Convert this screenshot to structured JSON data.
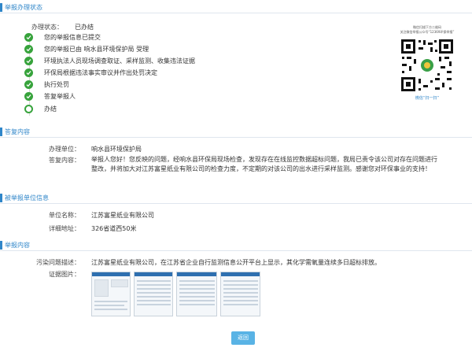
{
  "status_section": {
    "title": "举报办理状态",
    "status_label": "办理状态：",
    "status_value": "已办结",
    "steps": [
      "您的举报信息已提交",
      "您的举报已由 响水县环境保护局 受理",
      "环境执法人员现场调查取证、采样监测、收集违法证据",
      "环保局根据违法事实审议并作出处罚决定",
      "执行处罚",
      "答复举报人",
      "办结"
    ]
  },
  "qr": {
    "note_line1": "微信扫描下方二维码",
    "note_line2": "关注微信举报公众号“12369环保举报”",
    "caption": "微信“扫一扫”"
  },
  "reply_section": {
    "title": "答复内容",
    "unit_label": "办理单位：",
    "unit_value": "响水县环境保护局",
    "content_label": "答复内容：",
    "content_value": "举报人您好！您反映的问题，经响水县环保局现场检查，发现存在在线监控数据超标问题，我局已责令该公司对存在问题进行整改，并将加大对江苏富星纸业有限公司的检查力度，不定期的对该公司的出水进行采样监测。感谢您对环保事业的支持！"
  },
  "reported_section": {
    "title": "被举报单位信息",
    "name_label": "单位名称：",
    "name_value": "江苏富星纸业有限公司",
    "address_label": "详细地址：",
    "address_value": "326省道西50米"
  },
  "report_section": {
    "title": "举报内容",
    "desc_label": "污染问题描述：",
    "desc_value": "江苏富星纸业有限公司，在江苏省企业自行监测信息公开平台上显示，其化学需氧量连续多日超标排放。",
    "evidence_label": "证据图片："
  },
  "back_button": "返回",
  "colors": {
    "accent": "#2f86c9",
    "step_done": "#37a33c",
    "button": "#59b3e5"
  }
}
